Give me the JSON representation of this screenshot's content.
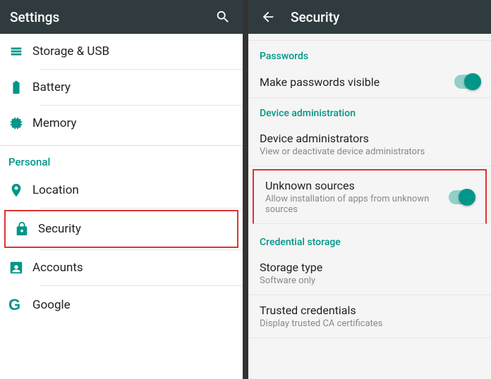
{
  "left": {
    "appbar": {
      "title": "Settings"
    },
    "items": {
      "storage": "Storage & USB",
      "battery": "Battery",
      "memory": "Memory"
    },
    "section_personal": "Personal",
    "personal_items": {
      "location": "Location",
      "security": "Security",
      "accounts": "Accounts",
      "google": "Google"
    }
  },
  "right": {
    "appbar": {
      "title": "Security"
    },
    "section_passwords": "Passwords",
    "passwords_visible": {
      "label": "Make passwords visible"
    },
    "section_device_admin": "Device administration",
    "device_admins": {
      "label": "Device administrators",
      "sub": "View or deactivate device administrators"
    },
    "unknown_sources": {
      "label": "Unknown sources",
      "sub": "Allow installation of apps from unknown sources"
    },
    "section_cred": "Credential storage",
    "storage_type": {
      "label": "Storage type",
      "sub": "Software only"
    },
    "trusted": {
      "label": "Trusted credentials",
      "sub": "Display trusted CA certificates"
    }
  }
}
